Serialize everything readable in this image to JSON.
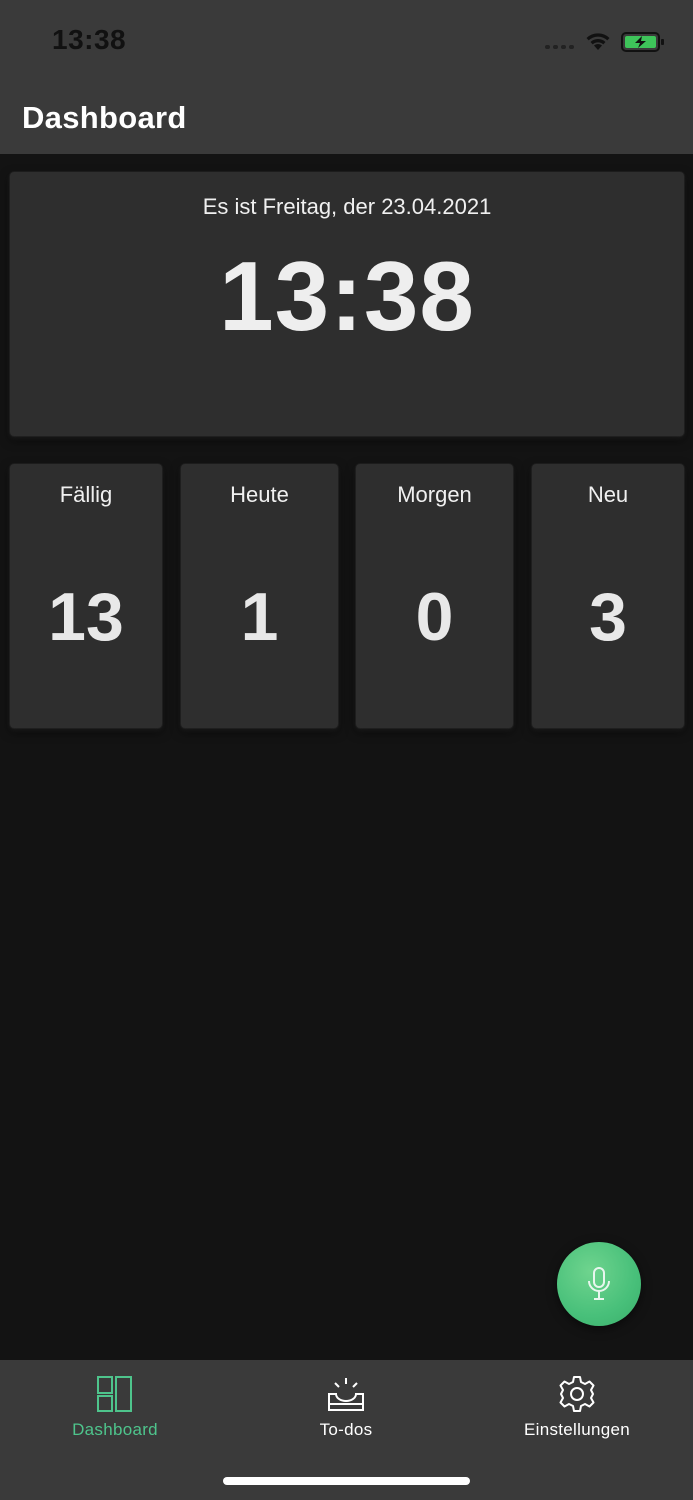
{
  "status_bar": {
    "time": "13:38"
  },
  "header": {
    "title": "Dashboard"
  },
  "date_card": {
    "date_line": "Es ist Freitag, der 23.04.2021",
    "clock": "13:38"
  },
  "stats": [
    {
      "label": "Fällig",
      "value": "13"
    },
    {
      "label": "Heute",
      "value": "1"
    },
    {
      "label": "Morgen",
      "value": "0"
    },
    {
      "label": "Neu",
      "value": "3"
    }
  ],
  "tab_bar": {
    "tabs": [
      {
        "label": "Dashboard",
        "icon": "dashboard-icon",
        "active": true
      },
      {
        "label": "To-dos",
        "icon": "todos-icon",
        "active": false
      },
      {
        "label": "Einstellungen",
        "icon": "gear-icon",
        "active": false
      }
    ]
  },
  "colors": {
    "accent": "#4ec48c",
    "background": "#131313",
    "card": "#2e2e2e",
    "bars": "#3a3a3a"
  }
}
